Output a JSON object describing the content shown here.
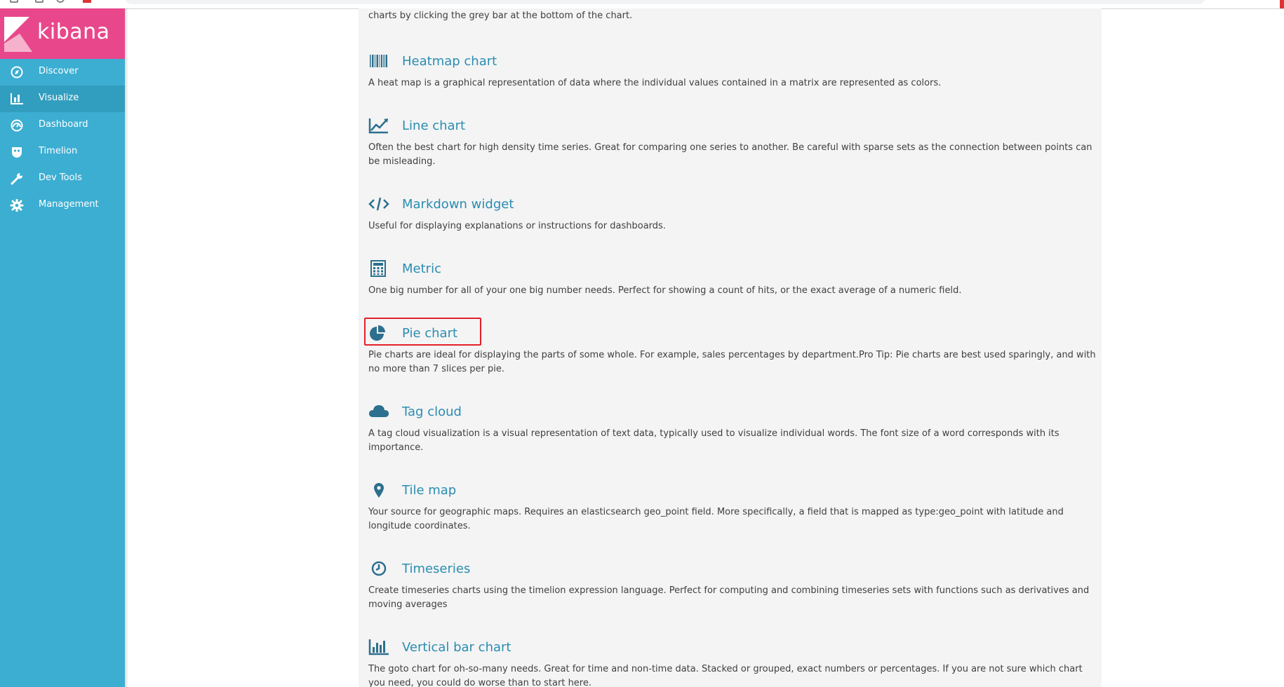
{
  "app": {
    "logo_text": "kibana"
  },
  "sidebar": {
    "items": [
      {
        "label": "Discover",
        "icon": "compass-icon",
        "active": false
      },
      {
        "label": "Visualize",
        "icon": "bar-chart-icon",
        "active": true
      },
      {
        "label": "Dashboard",
        "icon": "dashboard-icon",
        "active": false
      },
      {
        "label": "Timelion",
        "icon": "timelion-mask-icon",
        "active": false
      },
      {
        "label": "Dev Tools",
        "icon": "wrench-icon",
        "active": false
      },
      {
        "label": "Management",
        "icon": "gear-icon",
        "active": false
      }
    ]
  },
  "content": {
    "intro_tail": "charts by clicking the grey bar at the bottom of the chart.",
    "items": [
      {
        "title": "Heatmap chart",
        "icon": "heatmap-icon",
        "description": "A heat map is a graphical representation of data where the individual values contained in a matrix are represented as colors."
      },
      {
        "title": "Line chart",
        "icon": "line-chart-icon",
        "description": "Often the best chart for high density time series. Great for comparing one series to another. Be careful with sparse sets as the connection between points can be misleading."
      },
      {
        "title": "Markdown widget",
        "icon": "code-icon",
        "description": "Useful for displaying explanations or instructions for dashboards."
      },
      {
        "title": "Metric",
        "icon": "calculator-icon",
        "description": "One big number for all of your one big number needs. Perfect for showing a count of hits, or the exact average of a numeric field."
      },
      {
        "title": "Pie chart",
        "icon": "pie-chart-icon",
        "description": "Pie charts are ideal for displaying the parts of some whole. For example, sales percentages by department.Pro Tip: Pie charts are best used sparingly, and with no more than 7 slices per pie.",
        "highlighted": true
      },
      {
        "title": "Tag cloud",
        "icon": "cloud-icon",
        "description": "A tag cloud visualization is a visual representation of text data, typically used to visualize individual words. The font size of a word corresponds with its importance."
      },
      {
        "title": "Tile map",
        "icon": "map-marker-icon",
        "description": "Your source for geographic maps. Requires an elasticsearch geo_point field. More specifically, a field that is mapped as type:geo_point with latitude and longitude coordinates."
      },
      {
        "title": "Timeseries",
        "icon": "clock-icon",
        "description": "Create timeseries charts using the timelion expression language. Perfect for computing and combining timeseries sets with functions such as derivatives and moving averages"
      },
      {
        "title": "Vertical bar chart",
        "icon": "vertical-bar-chart-icon",
        "description": "The goto chart for oh-so-many needs. Great for time and non-time data. Stacked or grouped, exact numbers or percentages. If you are not sure which chart you need, you could do worse than to start here."
      }
    ]
  },
  "colors": {
    "sidebar": "#3caed2",
    "sidebar_active": "#329ebf",
    "logo_bg": "#e8488b",
    "link": "#2a8db1",
    "icon": "#2c6f8e",
    "highlight_border": "#e3202a",
    "content_bg": "#f4f4f4"
  }
}
